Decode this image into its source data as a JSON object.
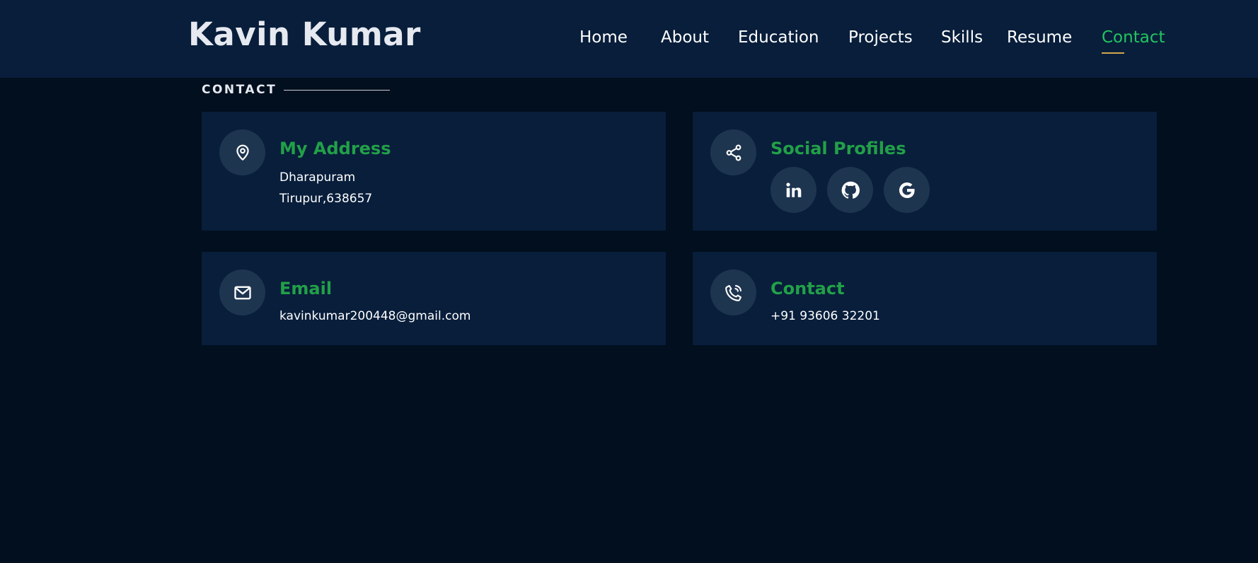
{
  "header": {
    "logo": "Kavin Kumar",
    "nav": [
      {
        "label": "Home",
        "active": false
      },
      {
        "label": "About",
        "active": false
      },
      {
        "label": "Education",
        "active": false
      },
      {
        "label": "Projects",
        "active": false
      },
      {
        "label": "Skills",
        "active": false
      },
      {
        "label": "Resume",
        "active": false
      },
      {
        "label": "Contact",
        "active": true
      }
    ]
  },
  "section": {
    "title": "CONTACT"
  },
  "cards": {
    "address": {
      "icon": "map-pin-icon",
      "title": "My Address",
      "line1": "Dharapuram",
      "line2": "Tirupur,638657"
    },
    "social": {
      "icon": "share-icon",
      "title": "Social Profiles",
      "links": [
        {
          "icon": "linkedin-icon"
        },
        {
          "icon": "github-icon"
        },
        {
          "icon": "google-icon"
        }
      ]
    },
    "email": {
      "icon": "mail-icon",
      "title": "Email",
      "value": "kavinkumar200448@gmail.com"
    },
    "contact": {
      "icon": "phone-icon",
      "title": "Contact",
      "value": "+91 93606 32201"
    }
  },
  "colors": {
    "page_bg": "#010f1e",
    "header_bg": "#081e3b",
    "card_bg": "#081e3b",
    "accent_green": "#22a048",
    "nav_active": "#22c55e",
    "underline": "#d4a64a",
    "icon_circle": "#1e3550"
  }
}
